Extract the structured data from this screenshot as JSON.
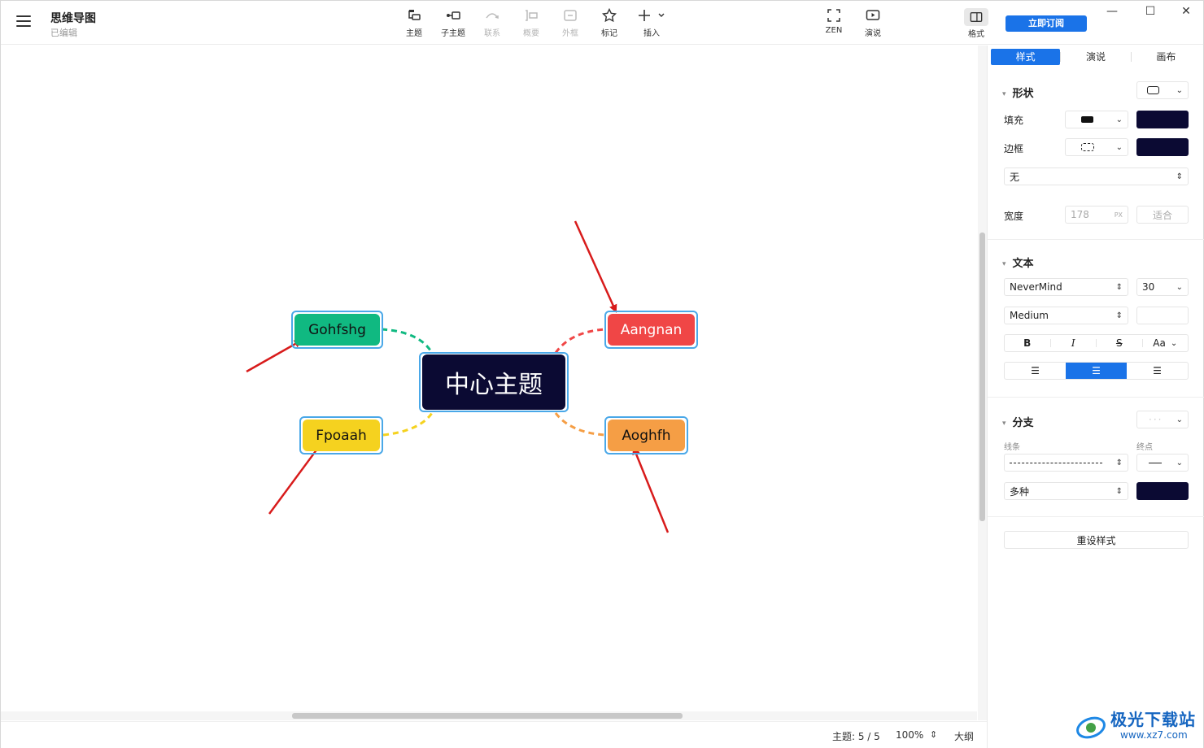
{
  "doc": {
    "title": "思维导图",
    "status": "已编辑"
  },
  "toolbar": {
    "topic": "主题",
    "subtopic": "子主题",
    "relation": "联系",
    "summary": "概要",
    "boundary": "外框",
    "marker": "标记",
    "insert": "插入",
    "zen": "ZEN",
    "present": "演说",
    "format": "格式",
    "subscribe": "立即订阅"
  },
  "mindmap": {
    "central": {
      "label": "中心主题",
      "color": "#0b0a33"
    },
    "branches": [
      {
        "label": "Gohfshg",
        "color": "#10b981",
        "text_color": "#111111"
      },
      {
        "label": "Aangnan",
        "color": "#f04646",
        "text_color": "#ffffff"
      },
      {
        "label": "Fpoaah",
        "color": "#f5d21f",
        "text_color": "#111111"
      },
      {
        "label": "Aoghfh",
        "color": "#f59e45",
        "text_color": "#111111"
      }
    ]
  },
  "status": {
    "topics": "主题: 5 / 5",
    "zoom": "100%",
    "outline": "大纲"
  },
  "panel": {
    "tabs": [
      "样式",
      "演说",
      "画布"
    ],
    "shape": {
      "title": "形状",
      "fill_label": "填充",
      "border_label": "边框",
      "fill_color": "#0b0a33",
      "border_color": "#0b0a33",
      "border_style": "无",
      "width_label": "宽度",
      "width_value": "178",
      "width_unit": "PX",
      "fit": "适合"
    },
    "text": {
      "title": "文本",
      "font": "NeverMind",
      "size": "30",
      "weight": "Medium",
      "bold": "B",
      "italic": "I",
      "strike": "S",
      "case": "Aa"
    },
    "branch": {
      "title": "分支",
      "line_label": "线条",
      "end_label": "终点",
      "color_mode": "多种",
      "color": "#0b0a33"
    },
    "reset": "重设样式"
  },
  "watermark": {
    "text": "极光下载站",
    "url": "www.xz7.com"
  }
}
